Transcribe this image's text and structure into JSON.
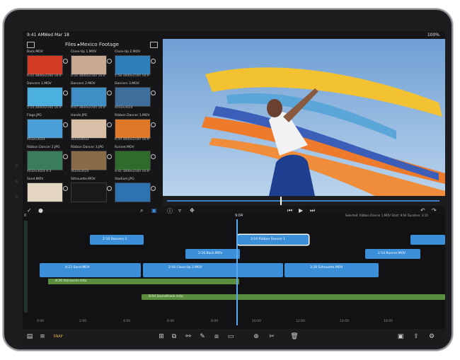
{
  "status_bar": {
    "time": "9:41 AM",
    "date": "Wed Mar 18",
    "battery": "100%"
  },
  "browser": {
    "title": "Files ▸Mexico Footage",
    "items": [
      {
        "name": "Back.MOV",
        "meta": "6:22  3840x2160  16:9",
        "color": "#d33a24"
      },
      {
        "name": "Close-Up 1.MOV",
        "meta": "0:16  3840x2160  16:9",
        "color": "#c9a98f"
      },
      {
        "name": "Close-Up 2.MOV",
        "meta": "1:58  3840x2160  16:9",
        "color": "#2f7fb8"
      },
      {
        "name": "Dancers 1.MOV",
        "meta": "5:14  3840x2160  16:9",
        "color": "#4bb0e0"
      },
      {
        "name": "Dancers 2.MOV",
        "meta": "9:07  3840x2160  16:9",
        "color": "#3f8fc6"
      },
      {
        "name": "Dancers 3.MOV",
        "meta": "4032x3024",
        "color": "#3e6e9c"
      },
      {
        "name": "Flags.JPG",
        "meta": "4032x3024",
        "color": "#4a9fd6"
      },
      {
        "name": "Hands.JPG",
        "meta": "3024x4032",
        "color": "#d8c0a8"
      },
      {
        "name": "Ribbon Dancer 1.MOV",
        "meta": "6:34  3840x2160  16:9",
        "color": "#e0782a"
      },
      {
        "name": "Ribbon Dancer 2.JPG",
        "meta": "4032x3024  4:3",
        "color": "#3a7d5a"
      },
      {
        "name": "Ribbon Dancer 3.JPG",
        "meta": "3024x3024",
        "color": "#8a6b48"
      },
      {
        "name": "Runner.MOV",
        "meta": "4:41  3840x2160  16:9",
        "color": "#2f6b2a"
      },
      {
        "name": "Sand.MOV",
        "meta": "",
        "color": "#e4d5c2"
      },
      {
        "name": "Silhouette.MOV",
        "meta": "",
        "color": "#1a1a1a"
      },
      {
        "name": "Stadium.JPG",
        "meta": "",
        "color": "#2d73b0"
      }
    ]
  },
  "timeline": {
    "playhead": "9:04",
    "info": "Selected: Ribbon Dancer 1.MOV  Start: 9:04  Duration: 3:10",
    "level_top": "0",
    "clips": [
      {
        "label": "2:16  Dancers 1",
        "color": "#3b8fd9"
      },
      {
        "label": "3:10  Ribbon Dancer 1",
        "color": "#3b8fd9"
      },
      {
        "label": "2:16  Back.MOV",
        "color": "#3b8fd9"
      },
      {
        "label": "2:14  Runner.MOV",
        "color": "#3b8fd9"
      },
      {
        "label": "4:23  Sand.MOV",
        "color": "#3b8fd9"
      },
      {
        "label": "2:04  Close-Up 2.MOV",
        "color": "#3b8fd9"
      },
      {
        "label": "3:28  Silhouette.MOV",
        "color": "#3b8fd9"
      }
    ],
    "audio": [
      {
        "label": "8:26  Voiceover.m4a",
        "color": "#5b8d3e"
      },
      {
        "label": "8:04  Soundtrack.m4a",
        "color": "#5b8d3e"
      }
    ],
    "ruler": [
      "0:00",
      "2:00",
      "4:00",
      "6:00",
      "8:00",
      "10:00",
      "12:00",
      "14:00",
      "16:00"
    ]
  },
  "toolbar": {
    "snap_label": "SNAP"
  }
}
